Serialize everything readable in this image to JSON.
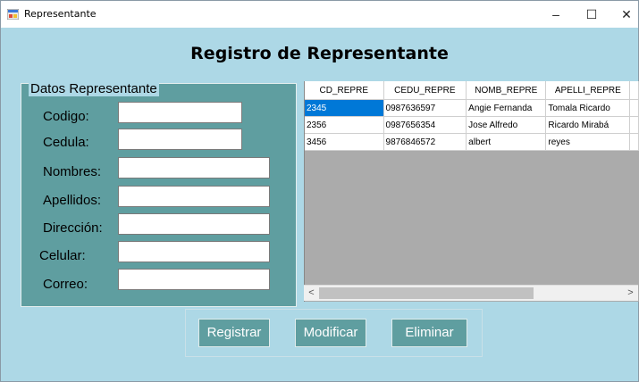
{
  "window": {
    "title": "Representante",
    "minimize": "–",
    "maximize": "☐",
    "close": "✕"
  },
  "form": {
    "heading": "Registro de Representante",
    "group_title": "Datos Representante",
    "fields": {
      "codigo": {
        "label": "Codigo:",
        "value": ""
      },
      "cedula": {
        "label": "Cedula:",
        "value": ""
      },
      "nombres": {
        "label": "Nombres:",
        "value": ""
      },
      "apellidos": {
        "label": "Apellidos:",
        "value": ""
      },
      "direccion": {
        "label": "Dirección:",
        "value": ""
      },
      "celular": {
        "label": "Celular:",
        "value": ""
      },
      "correo": {
        "label": "Correo:",
        "value": ""
      }
    }
  },
  "grid": {
    "columns": [
      "CD_REPRE",
      "CEDU_REPRE",
      "NOMB_REPRE",
      "APELLI_REPRE"
    ],
    "rows": [
      [
        "2345",
        "0987636597",
        "Angie Fernanda",
        "Tomala Ricardo"
      ],
      [
        "2356",
        "0987656354",
        "Jose Alfredo",
        "Ricardo Mirabá"
      ],
      [
        "3456",
        "9876846572",
        "albert",
        "reyes"
      ]
    ],
    "scroll_left": "<",
    "scroll_right": ">"
  },
  "buttons": {
    "registrar": "Registrar",
    "modificar": "Modificar",
    "eliminar": "Eliminar"
  },
  "colors": {
    "background": "#add8e6",
    "panel": "#5f9ea0",
    "selection": "#0078d7"
  }
}
